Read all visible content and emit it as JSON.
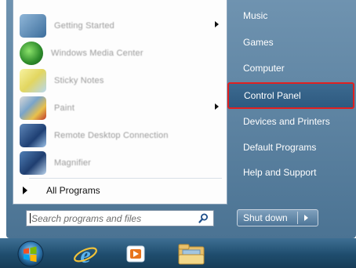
{
  "left_panel": {
    "programs": [
      {
        "label": "Getting Started",
        "icon": "getting-started-icon",
        "has_submenu": true
      },
      {
        "label": "Windows Media Center",
        "icon": "media-center-icon",
        "has_submenu": false
      },
      {
        "label": "Sticky Notes",
        "icon": "sticky-notes-icon",
        "has_submenu": false
      },
      {
        "label": "Paint",
        "icon": "paint-icon",
        "has_submenu": true
      },
      {
        "label": "Remote Desktop Connection",
        "icon": "remote-desktop-icon",
        "has_submenu": false
      },
      {
        "label": "Magnifier",
        "icon": "magnifier-icon",
        "has_submenu": false
      }
    ],
    "all_programs_label": "All Programs"
  },
  "search": {
    "placeholder": "Search programs and files"
  },
  "right_panel": {
    "items": [
      {
        "label": "Music"
      },
      {
        "label": "Games"
      },
      {
        "label": "Computer"
      },
      {
        "label": "Control Panel",
        "highlighted": true
      },
      {
        "label": "Devices and Printers"
      },
      {
        "label": "Default Programs"
      },
      {
        "label": "Help and Support"
      }
    ]
  },
  "shutdown": {
    "label": "Shut down"
  },
  "taskbar": {
    "items": [
      {
        "name": "start-orb",
        "icon": "windows-logo-icon"
      },
      {
        "name": "internet-explorer",
        "icon": "ie-icon"
      },
      {
        "name": "media-player",
        "icon": "media-player-icon"
      },
      {
        "name": "explorer",
        "icon": "folder-icon"
      }
    ]
  },
  "colors": {
    "highlight_border": "#e02020",
    "right_panel": "#4b7393"
  }
}
